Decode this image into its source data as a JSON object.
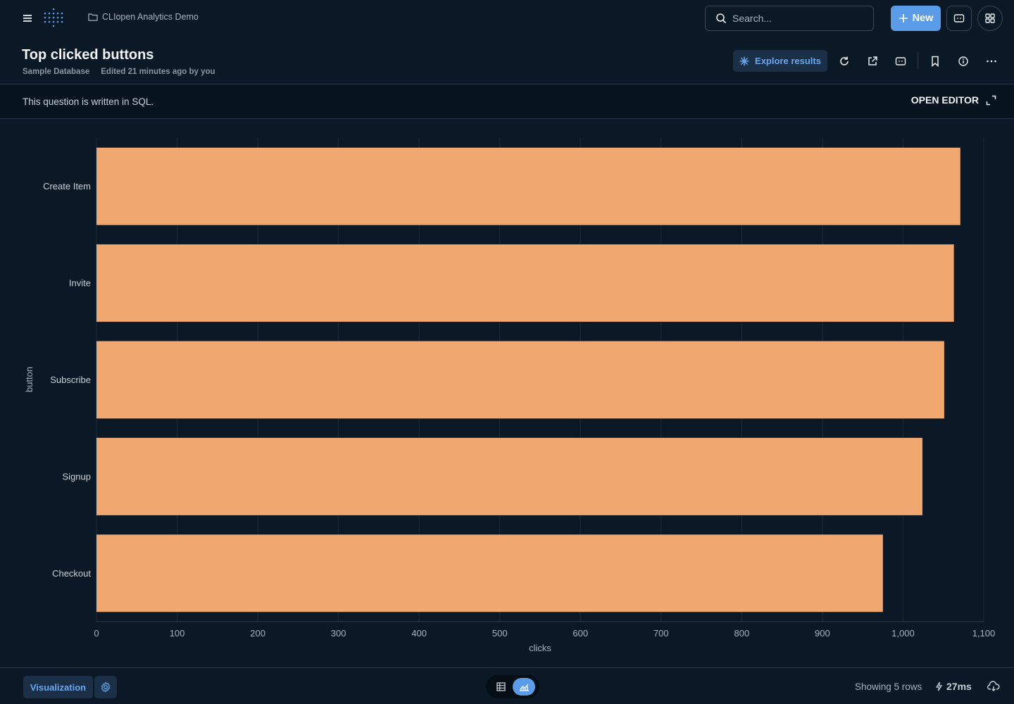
{
  "header": {
    "breadcrumb": "CLIopen Analytics Demo",
    "search_placeholder": "Search...",
    "new_label": "New"
  },
  "question": {
    "title": "Top clicked buttons",
    "database": "Sample Database",
    "edited": "Edited 21 minutes ago by you",
    "explore_label": "Explore results"
  },
  "sql_bar": {
    "note": "This question is written in SQL.",
    "open_editor": "OPEN EDITOR"
  },
  "footer": {
    "visualization_label": "Visualization",
    "rows": "Showing 5 rows",
    "timing": "27ms"
  },
  "colors": {
    "bar": "#f0a870",
    "accent": "#5b9ce8",
    "background": "#0b1825"
  },
  "chart_data": {
    "type": "bar",
    "orientation": "horizontal",
    "categories": [
      "Create Item",
      "Invite",
      "Subscribe",
      "Signup",
      "Checkout"
    ],
    "values": [
      1071,
      1063,
      1051,
      1024,
      975
    ],
    "xlabel": "clicks",
    "ylabel": "button",
    "xlim": [
      0,
      1100
    ],
    "xticks": [
      "0",
      "100",
      "200",
      "300",
      "400",
      "500",
      "600",
      "700",
      "800",
      "900",
      "1,000",
      "1,100"
    ],
    "grid": true
  }
}
